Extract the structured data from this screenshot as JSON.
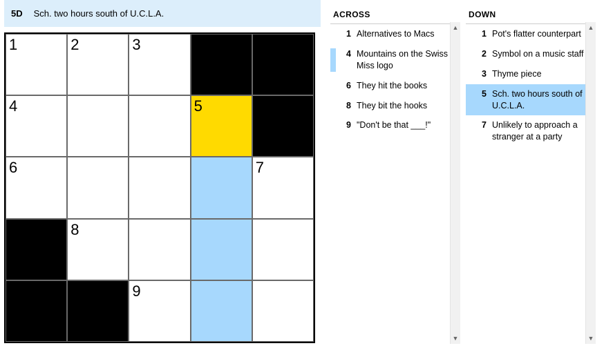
{
  "clue_bar": {
    "number": "5D",
    "text": "Sch. two hours south of U.C.L.A."
  },
  "grid": {
    "size": 5,
    "cells": [
      [
        {
          "n": "1"
        },
        {
          "n": "2"
        },
        {
          "n": "3"
        },
        {
          "black": true
        },
        {
          "black": true
        }
      ],
      [
        {
          "n": "4"
        },
        {},
        {},
        {
          "n": "5",
          "active": true
        },
        {
          "black": true
        }
      ],
      [
        {
          "n": "6"
        },
        {},
        {},
        {
          "word": true
        },
        {
          "n": "7"
        }
      ],
      [
        {
          "black": true
        },
        {
          "n": "8"
        },
        {},
        {
          "word": true
        },
        {}
      ],
      [
        {
          "black": true
        },
        {
          "black": true
        },
        {
          "n": "9"
        },
        {
          "word": true
        },
        {}
      ]
    ]
  },
  "across": {
    "title": "ACROSS",
    "clues": [
      {
        "n": "1",
        "t": "Alternatives to Macs"
      },
      {
        "n": "4",
        "t": "Mountains on the Swiss Miss logo",
        "related": true
      },
      {
        "n": "6",
        "t": "They hit the books"
      },
      {
        "n": "8",
        "t": "They bit the hooks"
      },
      {
        "n": "9",
        "t": "\"Don't be that ___!\""
      }
    ]
  },
  "down": {
    "title": "DOWN",
    "clues": [
      {
        "n": "1",
        "t": "Pot's flatter counterpart"
      },
      {
        "n": "2",
        "t": "Symbol on a music staff"
      },
      {
        "n": "3",
        "t": "Thyme piece"
      },
      {
        "n": "5",
        "t": "Sch. two hours south of U.C.L.A.",
        "selected": true
      },
      {
        "n": "7",
        "t": "Unlikely to approach a stranger at a party"
      }
    ]
  }
}
